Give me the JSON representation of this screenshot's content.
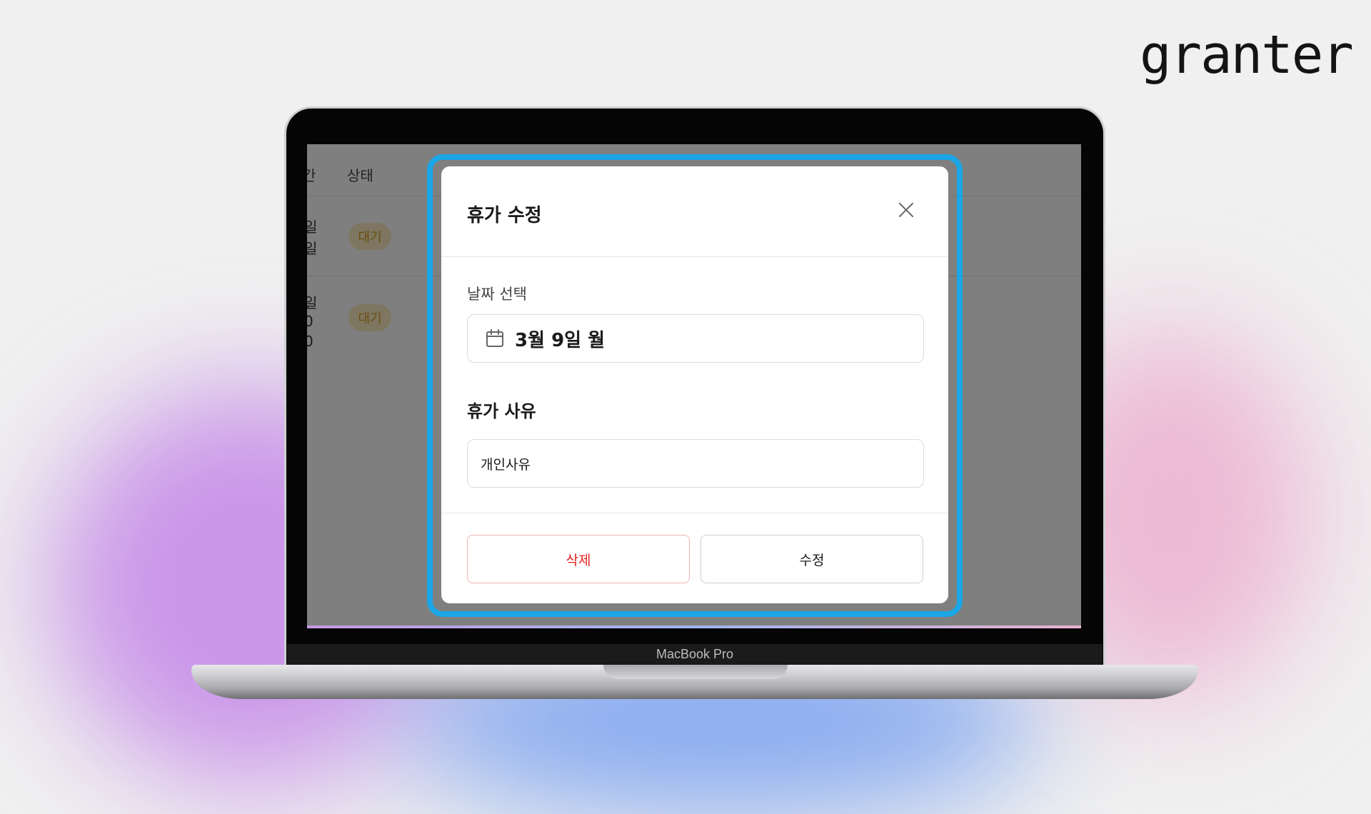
{
  "brand": {
    "logo_text": "granter"
  },
  "device": {
    "label": "MacBook Pro"
  },
  "background_page": {
    "headers": [
      "간",
      "상태"
    ],
    "rows": [
      {
        "fragments": [
          "일",
          "일"
        ],
        "status": "대기"
      },
      {
        "fragments": [
          "일",
          "0",
          "0"
        ],
        "status": "대기"
      }
    ]
  },
  "modal": {
    "title": "휴가 수정",
    "date_section": {
      "label": "날짜 선택",
      "value": "3월 9일 월"
    },
    "reason_section": {
      "title": "휴가 사유",
      "value": "개인사유"
    },
    "buttons": {
      "delete": "삭제",
      "edit": "수정"
    }
  },
  "colors": {
    "highlight": "#1ba6e6",
    "delete_text": "#e02020",
    "delete_border": "#f3b4b4",
    "badge_bg": "#fdecc0",
    "badge_text": "#d49a1c"
  },
  "icons": [
    "close-icon",
    "calendar-icon"
  ]
}
